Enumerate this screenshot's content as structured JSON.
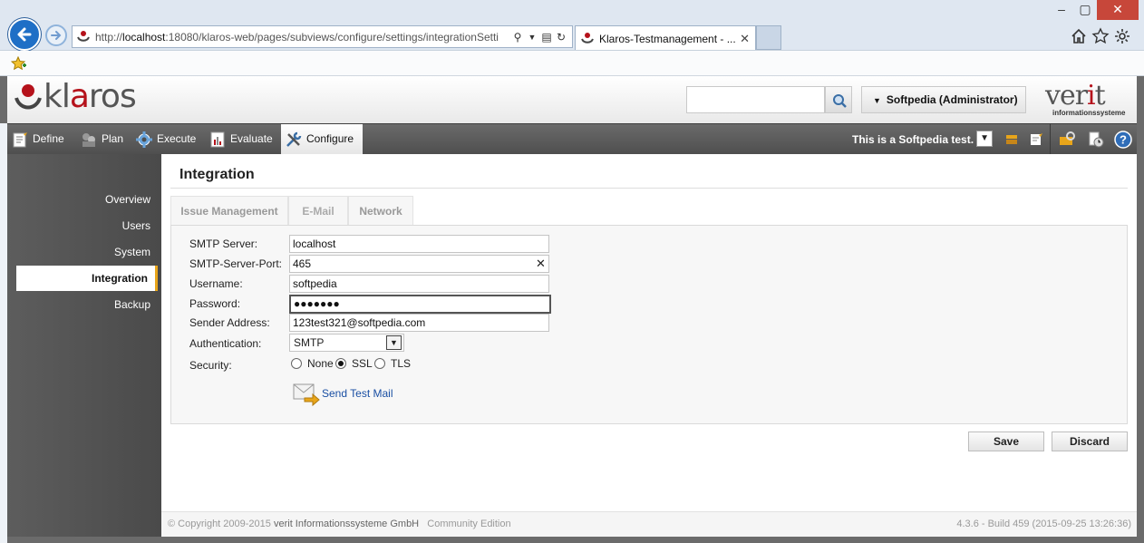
{
  "browser": {
    "url_prefix": "http://",
    "url_host": "localhost",
    "url_rest": ":18080/klaros-web/pages/subviews/configure/settings/integrationSetti",
    "tab_title": "Klaros-Testmanagement - ...",
    "tab_close": "✕",
    "icons": [
      "back-icon",
      "forward-icon",
      "search-icon",
      "compat-icon",
      "refresh-icon",
      "home-icon",
      "star-icon",
      "gear-icon"
    ]
  },
  "header": {
    "logo": "klaros",
    "user_label": "Softpedia (Administrator)",
    "company_logo": "verit",
    "company_sub": "informationssysteme",
    "search_value": ""
  },
  "nav": {
    "items": [
      {
        "label": "Define"
      },
      {
        "label": "Plan"
      },
      {
        "label": "Execute"
      },
      {
        "label": "Evaluate"
      },
      {
        "label": "Configure"
      }
    ],
    "test_select": "This is a Softpedia test."
  },
  "sidebar": {
    "items": [
      {
        "label": "Overview"
      },
      {
        "label": "Users"
      },
      {
        "label": "System"
      },
      {
        "label": "Integration"
      },
      {
        "label": "Backup"
      }
    ]
  },
  "page": {
    "title": "Integration",
    "tabs": [
      {
        "label": "Issue Management"
      },
      {
        "label": "E-Mail"
      },
      {
        "label": "Network"
      }
    ],
    "form": {
      "smtp_server_label": "SMTP Server:",
      "smtp_server_value": "localhost",
      "smtp_port_label": "SMTP-Server-Port:",
      "smtp_port_value": "465",
      "username_label": "Username:",
      "username_value": "softpedia",
      "password_label": "Password:",
      "password_value": "●●●●●●●",
      "sender_label": "Sender Address:",
      "sender_value": "123test321@softpedia.com",
      "auth_label": "Authentication:",
      "auth_value": "SMTP",
      "security_label": "Security:",
      "security_options": [
        "None",
        "SSL",
        "TLS"
      ],
      "security_selected": "SSL",
      "send_test_label": "Send Test Mail"
    },
    "buttons": {
      "save": "Save",
      "discard": "Discard"
    }
  },
  "footer": {
    "copyright": "© Copyright 2009-2015",
    "company": "verit Informationssysteme GmbH",
    "edition": "Community Edition",
    "version": "4.3.6 - Build 459 (2015-09-25 13:26:36)"
  },
  "colors": {
    "accent_red": "#b5121b",
    "nav_bg": "#5a5a5a",
    "active_marker": "#e8a51a",
    "link": "#1a4fa3"
  }
}
